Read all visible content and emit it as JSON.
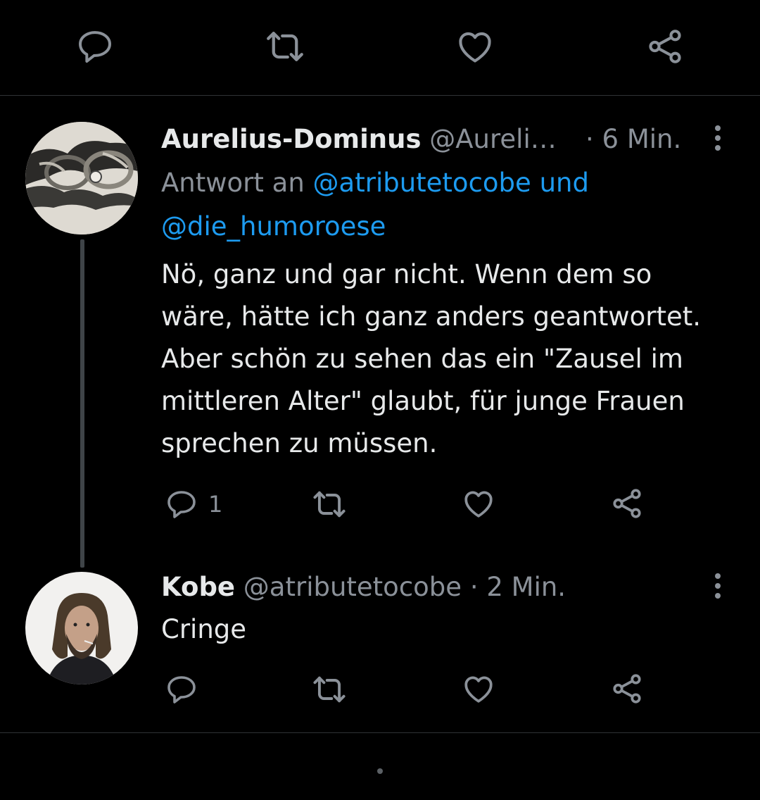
{
  "top_actions": {
    "reply": "reply-icon",
    "retweet": "retweet-icon",
    "like": "heart-icon",
    "share": "share-icon"
  },
  "tweets": [
    {
      "name": "Aurelius-Dominus",
      "handle": "@Aureli…",
      "time": "· 6 Min.",
      "reply_prefix": "Antwort an",
      "reply_mention_1": "@atributetocobe",
      "reply_and": "und",
      "reply_mention_2": "@die_humoroese",
      "body_lines": [
        "Nö, ganz und gar nicht. Wenn dem so",
        "wäre, hätte ich ganz anders geantwortet.",
        "Aber schön zu sehen das ein \"Zausel im",
        "mittleren Alter\" glaubt, für junge Frauen",
        "sprechen zu müssen."
      ],
      "reply_count": "1"
    },
    {
      "name": "Kobe",
      "handle": "@atributetocobe",
      "time": "· 2 Min.",
      "body_lines": [
        "Cringe"
      ],
      "reply_count": ""
    }
  ],
  "colors": {
    "background": "#000000",
    "text": "#e7e9ea",
    "secondary": "#8b9199",
    "link": "#1d9bf0",
    "divider": "#2f3336"
  }
}
